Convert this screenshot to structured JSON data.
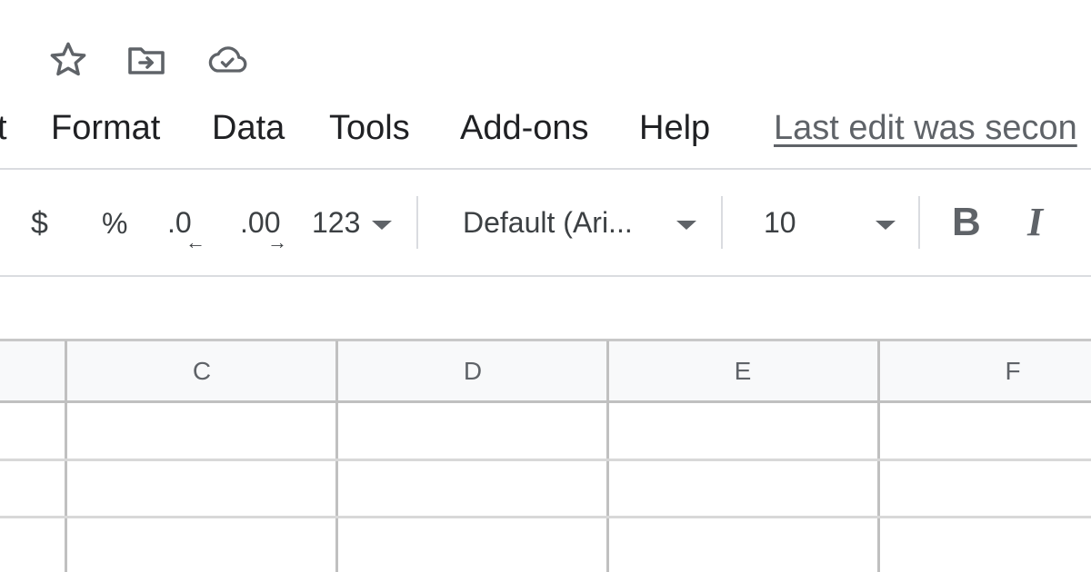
{
  "title_bar": {
    "icons": [
      "star-icon",
      "move-folder-icon",
      "cloud-saved-icon"
    ]
  },
  "menu": {
    "items": [
      "t",
      "Format",
      "Data",
      "Tools",
      "Add-ons",
      "Help"
    ],
    "last_edit": "Last edit was secon"
  },
  "toolbar": {
    "currency": "$",
    "percent": "%",
    "decrease_decimal": ".0",
    "increase_decimal": ".00",
    "more_formats": "123",
    "font_family": "Default (Ari...",
    "font_size": "10",
    "bold": "B",
    "italic": "I"
  },
  "grid": {
    "columns": [
      "C",
      "D",
      "E",
      "F"
    ]
  },
  "colors": {
    "text": "#3c4043",
    "menu_text": "#202124",
    "muted": "#5f6368",
    "border": "#dadce0",
    "header_bg": "#f8f9fa"
  }
}
